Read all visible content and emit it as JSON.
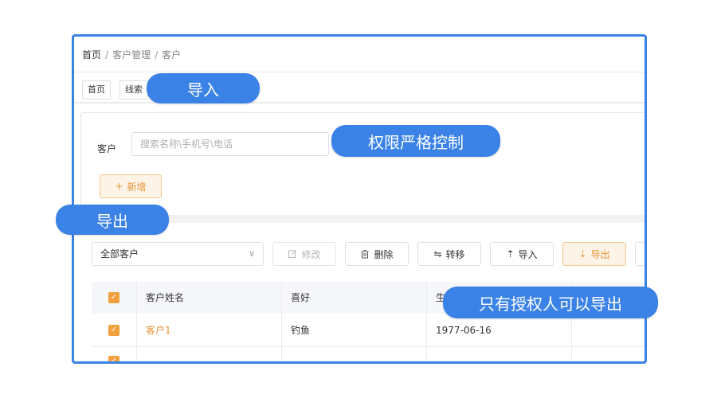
{
  "breadcrumb": {
    "home": "首页",
    "section": "客户管理",
    "current": "客户",
    "separator": "/"
  },
  "tabs": [
    {
      "label": "首页"
    },
    {
      "label": "线索"
    }
  ],
  "filter": {
    "label": "客户",
    "placeholder": "搜索名称\\手机号\\电话"
  },
  "add_button": {
    "label": "新增",
    "icon": "plus-icon"
  },
  "toolbar": {
    "select_value": "全部客户",
    "edit_label": "修改",
    "delete_label": "删除",
    "transfer_label": "转移",
    "import_label": "导入",
    "export_label": "导出"
  },
  "table": {
    "columns": [
      "客户姓名",
      "喜好",
      "生"
    ],
    "rows": [
      {
        "name": "客户1",
        "hobby": "钓鱼",
        "birthday": "1977-06-16"
      }
    ]
  },
  "callouts": {
    "import": "导入",
    "permission": "权限严格控制",
    "export": "导出",
    "authorized_export": "只有授权人可以导出"
  },
  "colors": {
    "frame": "#3b82e6",
    "accent": "#e6963a",
    "bubble": "#3b82e6"
  }
}
